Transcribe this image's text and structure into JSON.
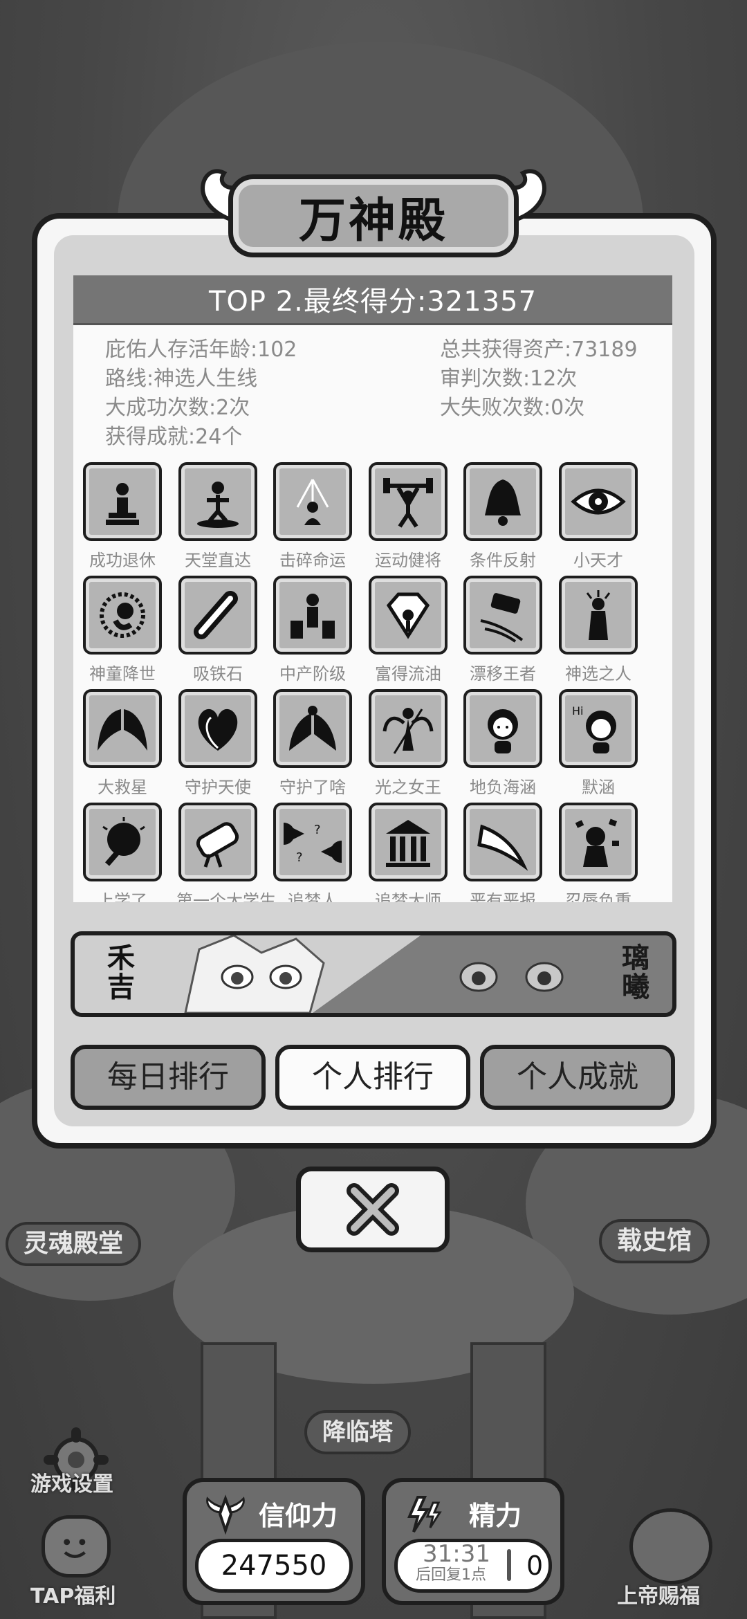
{
  "dialog": {
    "title": "万神殿",
    "header": "TOP 2.最终得分:321357",
    "stats": {
      "age": "庇佑人存活年龄:102",
      "assets": "总共获得资产:73189",
      "route": "路线:神选人生线",
      "judgements": "审判次数:12次",
      "great_success": "大成功次数:2次",
      "great_failure": "大失败次数:0次",
      "achievements_count": "获得成就:24个"
    },
    "achievements": [
      {
        "label": "成功退休",
        "icon": "retire-icon"
      },
      {
        "label": "天堂直达",
        "icon": "heaven-icon"
      },
      {
        "label": "击碎命运",
        "icon": "shatter-fate-icon"
      },
      {
        "label": "运动健将",
        "icon": "weightlifting-icon"
      },
      {
        "label": "条件反射",
        "icon": "bell-icon"
      },
      {
        "label": "小天才",
        "icon": "eye-icon"
      },
      {
        "label": "神童降世",
        "icon": "baby-icon"
      },
      {
        "label": "吸铁石",
        "icon": "magnet-icon"
      },
      {
        "label": "中产阶级",
        "icon": "middle-class-icon"
      },
      {
        "label": "富得流油",
        "icon": "diamond-icon"
      },
      {
        "label": "漂移王者",
        "icon": "drift-car-icon"
      },
      {
        "label": "神选之人",
        "icon": "chosen-one-icon"
      },
      {
        "label": "大救星",
        "icon": "wings-icon"
      },
      {
        "label": "守护天使",
        "icon": "heart-wings-icon"
      },
      {
        "label": "守护了啥",
        "icon": "fallen-angel-icon"
      },
      {
        "label": "光之女王",
        "icon": "light-queen-icon"
      },
      {
        "label": "地负海涵",
        "icon": "girl-icon"
      },
      {
        "label": "默涵",
        "icon": "girl-hi-icon"
      },
      {
        "label": "上学了",
        "icon": "school-icon"
      },
      {
        "label": "第一个大学生",
        "icon": "diploma-icon"
      },
      {
        "label": "追梦人",
        "icon": "pacman-icon"
      },
      {
        "label": "追梦大师",
        "icon": "temple-icon"
      },
      {
        "label": "恶有恶报",
        "icon": "boomerang-icon"
      },
      {
        "label": "忍辱负重",
        "icon": "burden-icon"
      }
    ],
    "characters": {
      "left": "禾吉",
      "right": "璃曦"
    },
    "tabs": [
      "每日排行",
      "个人排行",
      "个人成就"
    ],
    "active_tab": 1
  },
  "background": {
    "soul_hall": "灵魂殿堂",
    "history_hall": "载史馆",
    "descend_tower": "降临塔",
    "game_settings": "游戏设置",
    "tap_welfare": "TAP福利",
    "god_blessing": "上帝赐福"
  },
  "hud": {
    "faith_label": "信仰力",
    "faith_value": "247550",
    "energy_label": "精力",
    "energy_timer": "31:31",
    "energy_note": "后回复1点",
    "energy_value": "0"
  }
}
